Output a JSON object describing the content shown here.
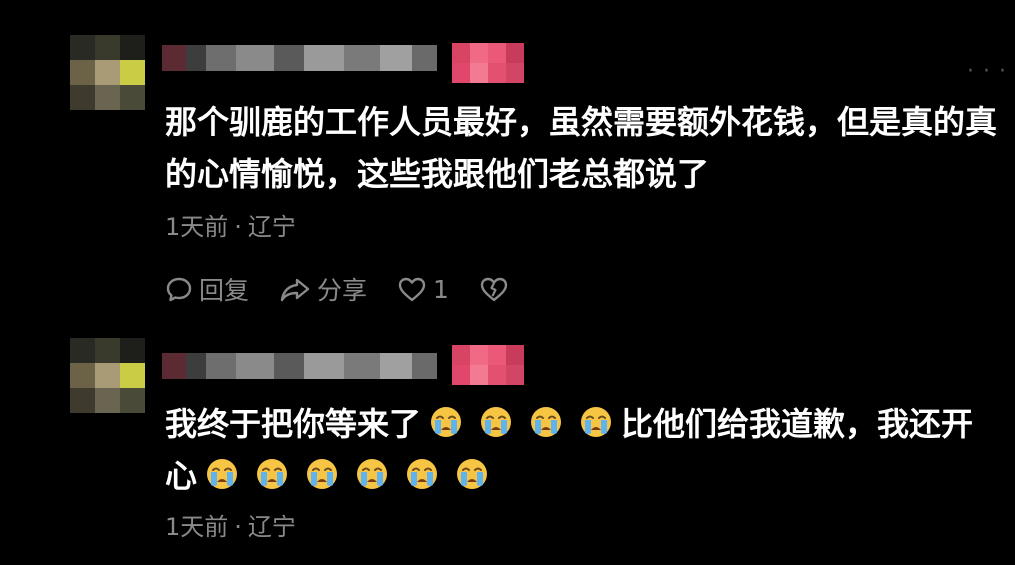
{
  "comments": [
    {
      "text": "那个驯鹿的工作人员最好，虽然需要额外花钱，但是真的真的心情愉悦，这些我跟他们老总都说了",
      "time": "1天前",
      "location": "辽宁",
      "reply_label": "回复",
      "share_label": "分享",
      "like_count": "1"
    },
    {
      "text_start": "我终于把你等来了",
      "text_middle": "比他们给我道歉，我还开心",
      "time": "1天前",
      "location": "辽宁"
    }
  ],
  "icons": {
    "more": "more-icon",
    "reply": "comment-bubble-icon",
    "share": "share-arrow-icon",
    "like": "heart-icon",
    "dislike": "broken-heart-icon",
    "emoji": "loudly-crying-face-emoji"
  },
  "colors": {
    "background": "#000000",
    "text": "#ffffff",
    "meta": "#8a8a8a",
    "badge": "#e0476a"
  },
  "separator": "·"
}
